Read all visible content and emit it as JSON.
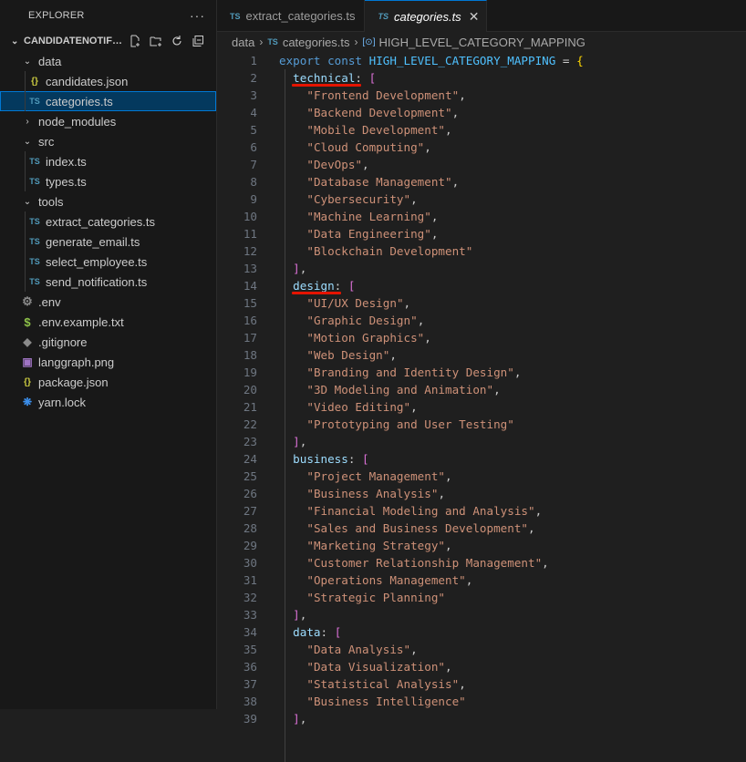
{
  "explorer": {
    "title": "EXPLORER",
    "section_title": "CANDIDATENOTIFI...",
    "items": [
      {
        "label": "data",
        "type": "folder",
        "expanded": true,
        "depth": 1
      },
      {
        "label": "candidates.json",
        "type": "json",
        "depth": 2
      },
      {
        "label": "categories.ts",
        "type": "ts",
        "depth": 2,
        "selected": true
      },
      {
        "label": "node_modules",
        "type": "folder",
        "expanded": false,
        "depth": 1
      },
      {
        "label": "src",
        "type": "folder",
        "expanded": true,
        "depth": 1
      },
      {
        "label": "index.ts",
        "type": "ts",
        "depth": 2
      },
      {
        "label": "types.ts",
        "type": "ts",
        "depth": 2
      },
      {
        "label": "tools",
        "type": "folder",
        "expanded": true,
        "depth": 1
      },
      {
        "label": "extract_categories.ts",
        "type": "ts",
        "depth": 2
      },
      {
        "label": "generate_email.ts",
        "type": "ts",
        "depth": 2
      },
      {
        "label": "select_employee.ts",
        "type": "ts",
        "depth": 2
      },
      {
        "label": "send_notification.ts",
        "type": "ts",
        "depth": 2
      },
      {
        "label": ".env",
        "type": "env",
        "depth": 1
      },
      {
        "label": ".env.example.txt",
        "type": "txt",
        "depth": 1
      },
      {
        "label": ".gitignore",
        "type": "git",
        "depth": 1
      },
      {
        "label": "langgraph.png",
        "type": "image",
        "depth": 1
      },
      {
        "label": "package.json",
        "type": "json",
        "depth": 1
      },
      {
        "label": "yarn.lock",
        "type": "yarn",
        "depth": 1
      }
    ]
  },
  "tabs": [
    {
      "label": "extract_categories.ts",
      "icon": "TS",
      "active": false
    },
    {
      "label": "categories.ts",
      "icon": "TS",
      "active": true
    }
  ],
  "breadcrumb": [
    "data",
    "categories.ts",
    "HIGH_LEVEL_CATEGORY_MAPPING"
  ],
  "code": {
    "start_line": 1,
    "export_kw": "export",
    "const_kw": "const",
    "const_name": "HIGH_LEVEL_CATEGORY_MAPPING",
    "categories": [
      {
        "key": "technical",
        "values": [
          "Frontend Development",
          "Backend Development",
          "Mobile Development",
          "Cloud Computing",
          "DevOps",
          "Database Management",
          "Cybersecurity",
          "Machine Learning",
          "Data Engineering",
          "Blockchain Development"
        ]
      },
      {
        "key": "design",
        "values": [
          "UI/UX Design",
          "Graphic Design",
          "Motion Graphics",
          "Web Design",
          "Branding and Identity Design",
          "3D Modeling and Animation",
          "Video Editing",
          "Prototyping and User Testing"
        ]
      },
      {
        "key": "business",
        "values": [
          "Project Management",
          "Business Analysis",
          "Financial Modeling and Analysis",
          "Sales and Business Development",
          "Marketing Strategy",
          "Customer Relationship Management",
          "Operations Management",
          "Strategic Planning"
        ]
      },
      {
        "key": "data",
        "values": [
          "Data Analysis",
          "Data Visualization",
          "Statistical Analysis",
          "Business Intelligence"
        ]
      }
    ],
    "underlined_keys": [
      "technical",
      "design"
    ]
  }
}
